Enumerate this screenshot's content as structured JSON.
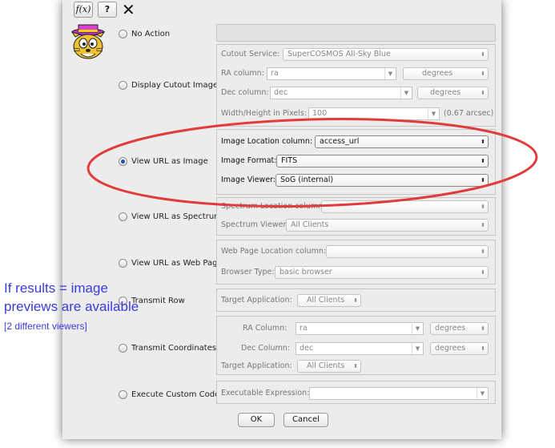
{
  "toolbar": {
    "fx_label": "f(x)",
    "help_label": "?",
    "close_glyph": "✕"
  },
  "options": [
    {
      "label": "No Action",
      "selected": false
    },
    {
      "label": "Display Cutout Image",
      "selected": false
    },
    {
      "label": "View URL as Image",
      "selected": true
    },
    {
      "label": "View URL as Spectrum",
      "selected": false
    },
    {
      "label": "View URL as Web Page",
      "selected": false
    },
    {
      "label": "Transmit Row",
      "selected": false
    },
    {
      "label": "Transmit Coordinates",
      "selected": false
    },
    {
      "label": "Execute Custom Code",
      "selected": false
    }
  ],
  "cutout": {
    "service_label": "Cutout Service:",
    "service_value": "SuperCOSMOS All-Sky Blue",
    "ra_label": "RA column:",
    "ra_value": "ra",
    "ra_units": "degrees",
    "dec_label": "Dec column:",
    "dec_value": "dec",
    "dec_units": "degrees",
    "size_label": "Width/Height in Pixels:",
    "size_value": "100",
    "size_note": "(0.67 arcsec)"
  },
  "image": {
    "location_label": "Image Location column:",
    "location_value": "access_url",
    "format_label": "Image Format:",
    "format_value": "FITS",
    "viewer_label": "Image Viewer:",
    "viewer_value": "SoG (internal)"
  },
  "spectrum": {
    "location_label": "Spectrum Location column:",
    "location_value": "",
    "viewer_label": "Spectrum Viewer:",
    "viewer_value": "All Clients"
  },
  "webpage": {
    "location_label": "Web Page Location column:",
    "location_value": "",
    "browser_label": "Browser Type:",
    "browser_value": "basic browser"
  },
  "transmit_row": {
    "target_label": "Target Application:",
    "target_value": "All Clients"
  },
  "transmit_coords": {
    "ra_label": "RA Column:",
    "ra_value": "ra",
    "ra_units": "degrees",
    "dec_label": "Dec Column:",
    "dec_value": "dec",
    "dec_units": "degrees",
    "target_label": "Target Application:",
    "target_value": "All Clients"
  },
  "custom_code": {
    "expr_label": "Executable Expression:",
    "expr_value": ""
  },
  "buttons": {
    "ok": "OK",
    "cancel": "Cancel"
  },
  "annotation": {
    "line1": "If results = image",
    "line2": "previews are available",
    "line3": "[2 different viewers]",
    "color": "#3b3bdf",
    "ellipse_color": "#e23b3b"
  }
}
